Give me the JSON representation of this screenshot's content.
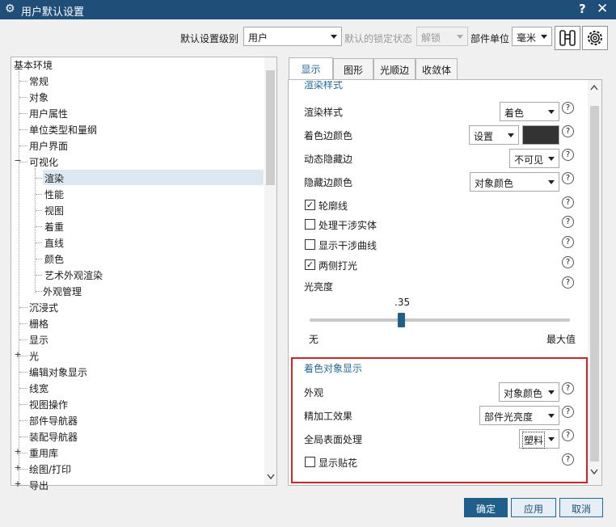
{
  "window": {
    "title": "用户默认设置",
    "help_glyph": "?",
    "close_glyph": "✕"
  },
  "toolbar": {
    "level_label": "默认设置级别",
    "level_value": "用户",
    "lock_label": "默认的锁定状态",
    "lock_value": "解锁",
    "unit_label": "部件单位",
    "unit_value": "毫米"
  },
  "tree": {
    "root": "基本环境",
    "items": [
      "常规",
      "对象",
      "用户属性",
      "单位类型和量纲",
      "用户界面",
      "可视化",
      "沉浸式",
      "栅格",
      "显示",
      "光",
      "编辑对象显示",
      "线宽",
      "视图操作",
      "部件导航器",
      "装配导航器",
      "重用库",
      "绘图/打印",
      "导出"
    ],
    "visual_children": [
      "渲染",
      "性能",
      "视图",
      "着重",
      "直线",
      "颜色",
      "艺术外观渲染",
      "外观管理"
    ],
    "expand_plus": "+",
    "expand_minus": "−"
  },
  "tabs": [
    "显示",
    "图形",
    "光顺边",
    "收敛体"
  ],
  "render_section": {
    "title": "渲染样式",
    "render_style_label": "渲染样式",
    "render_style_value": "着色",
    "edge_color_label": "着色边颜色",
    "edge_color_value": "设置",
    "edge_color_swatch": "#333333",
    "hidden_edge_label": "动态隐藏边",
    "hidden_edge_value": "不可见",
    "hidden_edge_color_label": "隐藏边颜色",
    "hidden_edge_color_value": "对象颜色",
    "silhouette_label": "轮廓线",
    "silhouette_checked": true,
    "interference_solid_label": "处理干涉实体",
    "interference_solid_checked": false,
    "interference_curve_label": "显示干涉曲线",
    "interference_curve_checked": false,
    "two_sided_label": "两侧打光",
    "two_sided_checked": true,
    "brightness_label": "光亮度",
    "brightness_value": ".35",
    "brightness_fraction": 0.35,
    "slider_min": "无",
    "slider_max": "最大值"
  },
  "shaded_section": {
    "title": "着色对象显示",
    "appearance_label": "外观",
    "appearance_value": "对象颜色",
    "finish_label": "精加工效果",
    "finish_value": "部件光亮度",
    "global_label": "全局表面处理",
    "global_value": "塑料",
    "decal_label": "显示贴花",
    "decal_checked": false
  },
  "help_glyph": "?",
  "check_glyph": "✓",
  "buttons": {
    "ok": "确定",
    "apply": "应用",
    "cancel": "取消"
  },
  "colors": {
    "titlebar": "#1f4e79",
    "accent": "#1f6aa5",
    "highlight_box": "#e02020",
    "tree_selected": "#dbe8f1"
  }
}
